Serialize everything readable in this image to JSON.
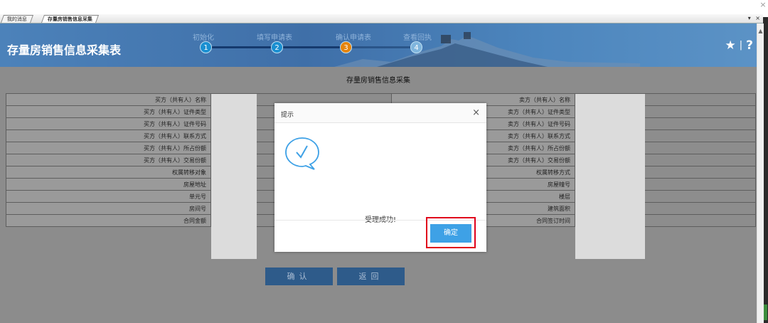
{
  "window": {
    "close_glyph": "×"
  },
  "tabs": [
    {
      "label": "我的消息"
    },
    {
      "label": "存量房销售信息采集"
    }
  ],
  "tab_controls": "▾ ×",
  "header": {
    "title": "存量房销售信息采集表",
    "steps": [
      {
        "number": "1",
        "label": "初始化"
      },
      {
        "number": "2",
        "label": "填写申请表"
      },
      {
        "number": "3",
        "label": "确认申请表"
      },
      {
        "number": "4",
        "label": "查看回执"
      }
    ],
    "star_icon": "★",
    "separator": "|",
    "help_icon": "?"
  },
  "form": {
    "title": "存量房销售信息采集",
    "left_labels": [
      "买方（共有人）名称",
      "买方（共有人）证件类型",
      "买方（共有人）证件号码",
      "买方（共有人）联系方式",
      "买方（共有人）所占份额",
      "买方（共有人）交易份额",
      "权属转移对象",
      "房屋地址",
      "单元号",
      "房间号",
      "合同金额"
    ],
    "right_labels": [
      "卖方（共有人）名称",
      "卖方（共有人）证件类型",
      "卖方（共有人）证件号码",
      "卖方（共有人）联系方式",
      "卖方（共有人）所占份额",
      "卖方（共有人）交易份额",
      "权属转移方式",
      "房屋幢号",
      "楼层",
      "建筑面积",
      "合同签订时间"
    ],
    "confirm_label": "确认",
    "back_label": "返回"
  },
  "dialog": {
    "title": "提示",
    "close_glyph": "×",
    "message": "受理成功!",
    "ok_label": "确定"
  },
  "colors": {
    "header_blue": "#4c82ba",
    "step_current": "#e6840d",
    "ok_button": "#3ea1e6",
    "highlight_red": "#e0001b"
  }
}
